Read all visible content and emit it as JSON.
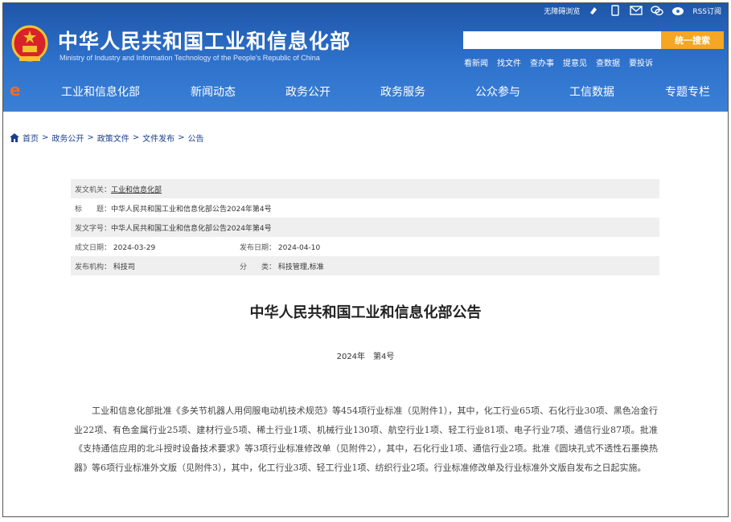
{
  "header": {
    "title": "中华人民共和国工业和信息化部",
    "subtitle": "Ministry of Industry and Information Technology of the People's Republic of China",
    "top_links": {
      "accessible": "无障碍浏览",
      "rss": "RSS订阅"
    },
    "search": {
      "placeholder": "",
      "button_label": "统一搜索"
    },
    "quick_links": [
      "看新闻",
      "找文件",
      "查办事",
      "提意见",
      "查数据",
      "要投诉"
    ]
  },
  "nav": {
    "items": [
      "工业和信息化部",
      "新闻动态",
      "政务公开",
      "政务服务",
      "公众参与",
      "工信数据",
      "专题专栏"
    ]
  },
  "breadcrumb": [
    "首页",
    "政务公开",
    "政策文件",
    "文件发布",
    "公告"
  ],
  "meta": {
    "issuer_label": "发文机关：",
    "issuer_value": "工业和信息化部",
    "title_label": "标　　题：",
    "title_value": "中华人民共和国工业和信息化部公告2024年第4号",
    "doc_no_label": "发文字号：",
    "doc_no_value": "中华人民共和国工业和信息化部公告2024年第4号",
    "written_date_label": "成文日期：",
    "written_date_value": "2024-03-29",
    "publish_date_label": "发布日期：",
    "publish_date_value": "2024-04-10",
    "org_label": "发布机构：",
    "org_value": "科技司",
    "category_label": "分　　类：",
    "category_value": "科技管理,标准"
  },
  "document": {
    "title": "中华人民共和国工业和信息化部公告",
    "number": "2024年　第4号",
    "body": "工业和信息化部批准《多关节机器人用伺服电动机技术规范》等454项行业标准（见附件1），其中，化工行业65项、石化行业30项、黑色冶金行业22项、有色金属行业25项、建材行业5项、稀土行业1项、机械行业130项、航空行业1项、轻工行业81项、电子行业7项、通信行业87项。批准《支持通信应用的北斗授时设备技术要求》等3项行业标准修改单（见附件2），其中，石化行业1项、通信行业2项。批准《圆块孔式不透性石墨换热器》等6项行业标准外文版（见附件3），其中，化工行业3项、轻工行业1项、纺织行业2项。行业标准修改单及行业标准外文版自发布之日起实施。"
  },
  "colors": {
    "header_blue": "#2e72cc",
    "search_orange": "#f5a623",
    "nav_accent": "#f36b21"
  }
}
